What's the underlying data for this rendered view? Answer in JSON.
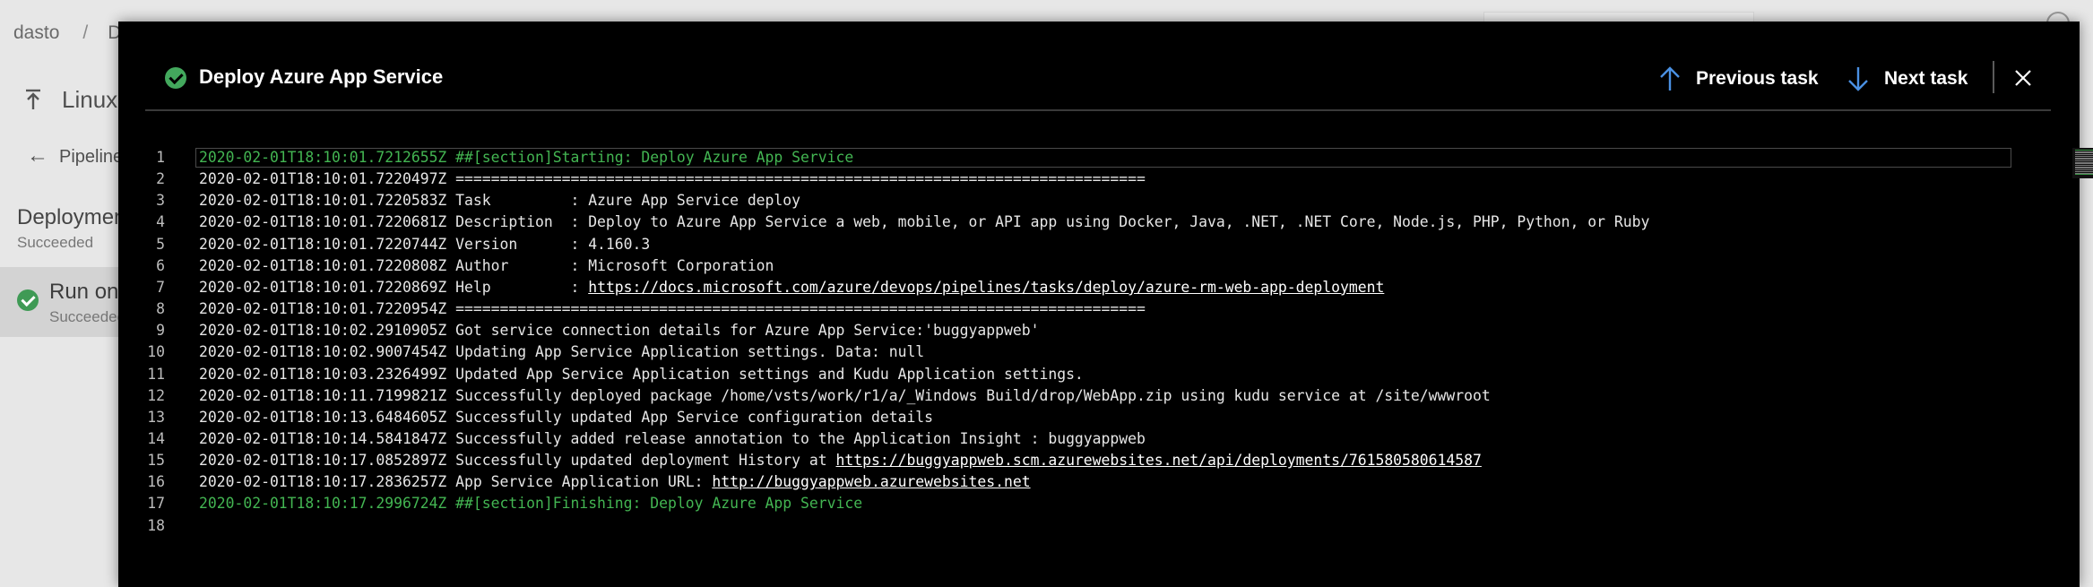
{
  "background": {
    "breadcrumb": [
      "dasto",
      "D"
    ],
    "page_title": "Linux",
    "back_label": "Pipeline",
    "stage_title": "Deploymen",
    "stage_status": "Succeeded",
    "run_label": "Run on",
    "run_status": "Succeedec"
  },
  "dialog": {
    "title": "Deploy Azure App Service",
    "status_icon": "check-circle-icon",
    "previous_label": "Previous task",
    "next_label": "Next task",
    "colors": {
      "success": "#43a85d",
      "accent_arrow": "#4a90e2",
      "section_text": "#43b552"
    }
  },
  "log": {
    "lines": [
      {
        "n": "1",
        "ts": "2020-02-01T18:10:01.7212655Z",
        "text": "##[section]Starting: Deploy Azure App Service",
        "kind": "section"
      },
      {
        "n": "2",
        "ts": "2020-02-01T18:10:01.7220497Z",
        "text": "==============================================================================",
        "kind": "normal"
      },
      {
        "n": "3",
        "ts": "2020-02-01T18:10:01.7220583Z",
        "text": "Task         : Azure App Service deploy",
        "kind": "normal"
      },
      {
        "n": "4",
        "ts": "2020-02-01T18:10:01.7220681Z",
        "text": "Description  : Deploy to Azure App Service a web, mobile, or API app using Docker, Java, .NET, .NET Core, Node.js, PHP, Python, or Ruby",
        "kind": "normal"
      },
      {
        "n": "5",
        "ts": "2020-02-01T18:10:01.7220744Z",
        "text": "Version      : 4.160.3",
        "kind": "normal"
      },
      {
        "n": "6",
        "ts": "2020-02-01T18:10:01.7220808Z",
        "text": "Author       : Microsoft Corporation",
        "kind": "normal"
      },
      {
        "n": "7",
        "ts": "2020-02-01T18:10:01.7220869Z",
        "text": "Help         : ",
        "link": "https://docs.microsoft.com/azure/devops/pipelines/tasks/deploy/azure-rm-web-app-deployment",
        "kind": "normal"
      },
      {
        "n": "8",
        "ts": "2020-02-01T18:10:01.7220954Z",
        "text": "==============================================================================",
        "kind": "normal"
      },
      {
        "n": "9",
        "ts": "2020-02-01T18:10:02.2910905Z",
        "text": "Got service connection details for Azure App Service:'buggyappweb'",
        "kind": "normal"
      },
      {
        "n": "10",
        "ts": "2020-02-01T18:10:02.9007454Z",
        "text": "Updating App Service Application settings. Data: null",
        "kind": "normal"
      },
      {
        "n": "11",
        "ts": "2020-02-01T18:10:03.2326499Z",
        "text": "Updated App Service Application settings and Kudu Application settings.",
        "kind": "normal"
      },
      {
        "n": "12",
        "ts": "2020-02-01T18:10:11.7199821Z",
        "text": "Successfully deployed package /home/vsts/work/r1/a/_Windows Build/drop/WebApp.zip using kudu service at /site/wwwroot",
        "kind": "normal"
      },
      {
        "n": "13",
        "ts": "2020-02-01T18:10:13.6484605Z",
        "text": "Successfully updated App Service configuration details",
        "kind": "normal"
      },
      {
        "n": "14",
        "ts": "2020-02-01T18:10:14.5841847Z",
        "text": "Successfully added release annotation to the Application Insight : buggyappweb",
        "kind": "normal"
      },
      {
        "n": "15",
        "ts": "2020-02-01T18:10:17.0852897Z",
        "text": "Successfully updated deployment History at ",
        "link": "https://buggyappweb.scm.azurewebsites.net/api/deployments/761580580614587",
        "kind": "normal"
      },
      {
        "n": "16",
        "ts": "2020-02-01T18:10:17.2836257Z",
        "text": "App Service Application URL: ",
        "link": "http://buggyappweb.azurewebsites.net",
        "kind": "normal"
      },
      {
        "n": "17",
        "ts": "2020-02-01T18:10:17.2996724Z",
        "text": "##[section]Finishing: Deploy Azure App Service",
        "kind": "section"
      },
      {
        "n": "18",
        "ts": "",
        "text": "",
        "kind": "normal"
      }
    ]
  }
}
